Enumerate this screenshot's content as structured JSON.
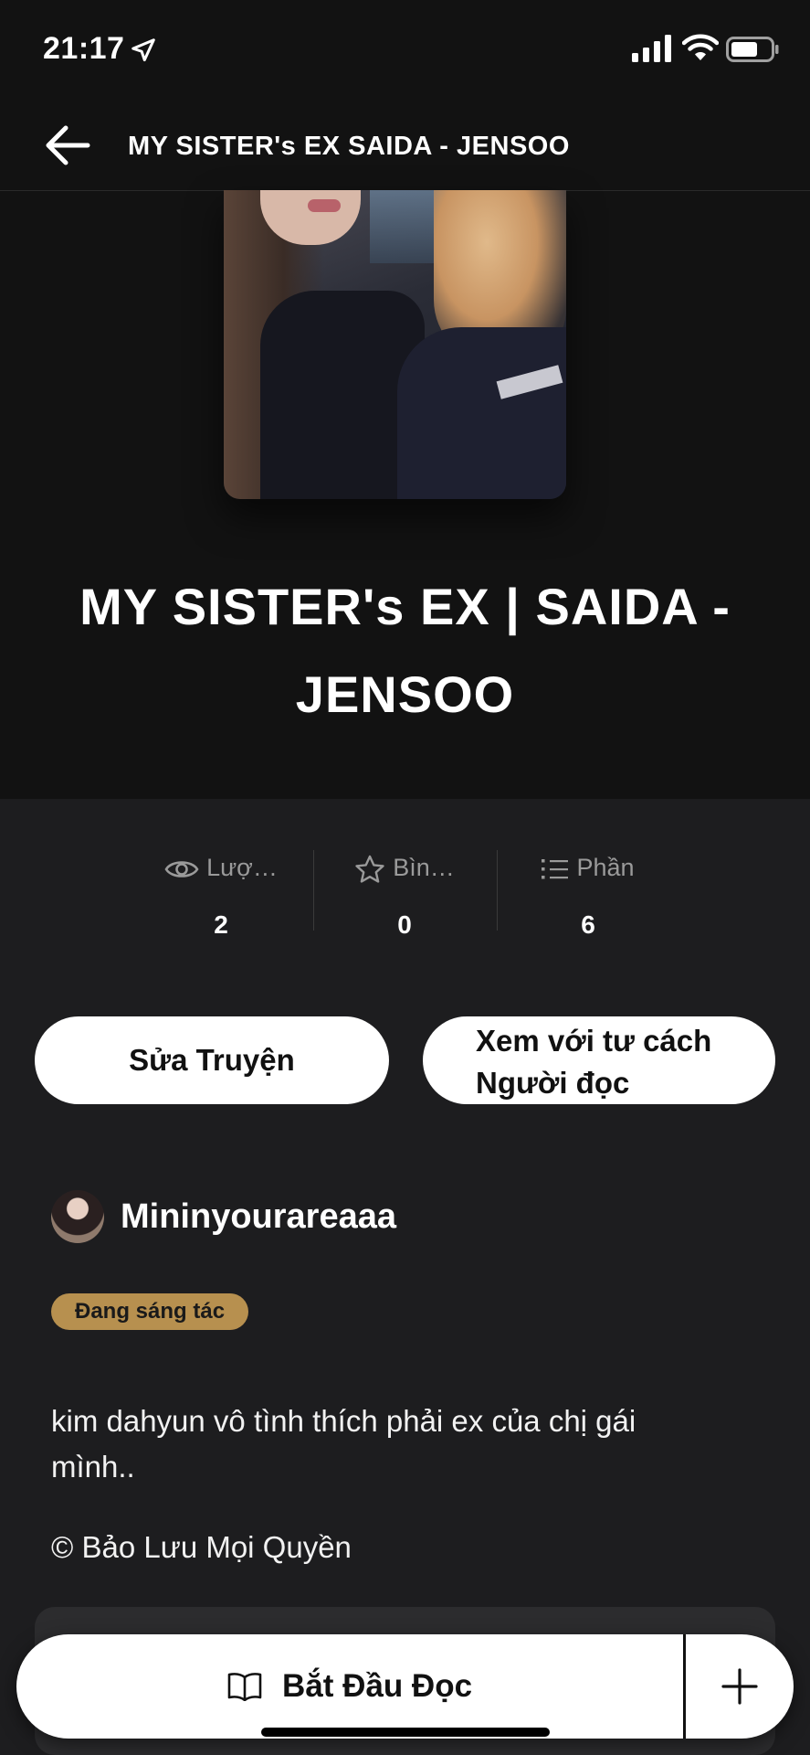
{
  "status_bar": {
    "time": "21:17"
  },
  "nav": {
    "title": "MY SISTER's EX  SAIDA - JENSOO"
  },
  "story": {
    "title": "MY SISTER's EX | SAIDA - JENSOO"
  },
  "stats": [
    {
      "icon": "eye-icon",
      "label": "Lượ…",
      "value": "2"
    },
    {
      "icon": "star-icon",
      "label": "Bìn…",
      "value": "0"
    },
    {
      "icon": "list-icon",
      "label": "Phần",
      "value": "6"
    }
  ],
  "actions": {
    "edit_label": "Sửa Truyện",
    "read_as_label": "Xem với tư cách Người đọc"
  },
  "author": {
    "name": "Mininyourareaaa"
  },
  "badge": {
    "label": "Đang sáng tác"
  },
  "description": "kim dahyun vô tình thích phải ex của chị gái mình..",
  "copyright": "© Bảo Lưu Mọi Quyền",
  "cta": {
    "start_label": "Bắt Đầu Đọc",
    "add_icon": "plus-icon"
  },
  "colors": {
    "badge": "#b7904f",
    "background": "#1d1d1f",
    "header_bg": "#121212"
  }
}
